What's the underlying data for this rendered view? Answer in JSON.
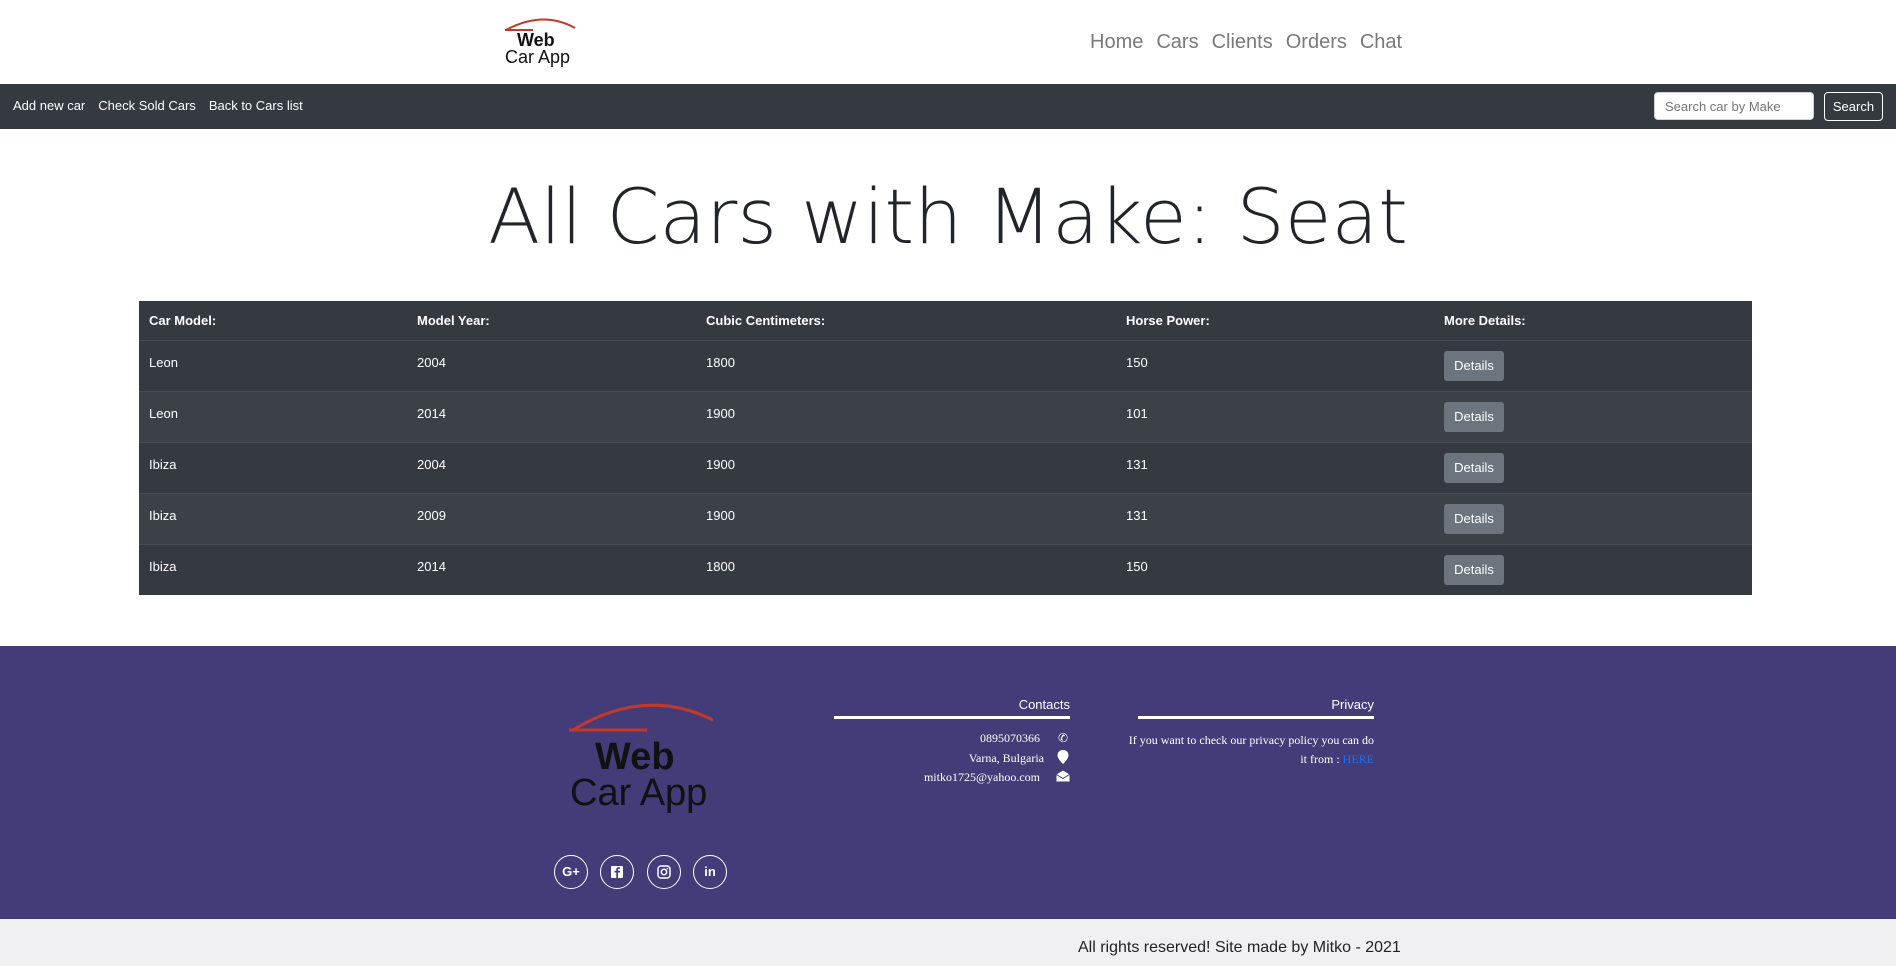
{
  "brand": {
    "line1": "Web",
    "line2": "Car App",
    "accent": "#c0392b"
  },
  "nav": {
    "items": [
      "Home",
      "Cars",
      "Clients",
      "Orders",
      "Chat"
    ]
  },
  "subnav": {
    "links": [
      "Add new car",
      "Check Sold Cars",
      "Back to Cars list"
    ],
    "search_placeholder": "Search car by Make",
    "search_label": "Search"
  },
  "title": "All Cars with Make: Seat",
  "table": {
    "headers": [
      "Car Model:",
      "Model Year:",
      "Cubic Centimeters:",
      "Horse Power:",
      "More Details:"
    ],
    "rows": [
      {
        "model": "Leon",
        "year": "2004",
        "cc": "1800",
        "hp": "150",
        "action": "Details"
      },
      {
        "model": "Leon",
        "year": "2014",
        "cc": "1900",
        "hp": "101",
        "action": "Details"
      },
      {
        "model": "Ibiza",
        "year": "2004",
        "cc": "1900",
        "hp": "131",
        "action": "Details"
      },
      {
        "model": "Ibiza",
        "year": "2009",
        "cc": "1900",
        "hp": "131",
        "action": "Details"
      },
      {
        "model": "Ibiza",
        "year": "2014",
        "cc": "1800",
        "hp": "150",
        "action": "Details"
      }
    ]
  },
  "footer": {
    "contacts_title": "Contacts",
    "phone": "0895070366",
    "address": "Varna, Bulgaria",
    "email": "mitko1725@yahoo.com",
    "privacy_title": "Privacy",
    "privacy_text": "If you want to check our privacy policy you can do it from : ",
    "privacy_link": "HERE",
    "social_icons": [
      "google-plus-icon",
      "facebook-icon",
      "instagram-icon",
      "linkedin-icon"
    ],
    "background": "#433c78"
  },
  "copyright": "All rights reserved! Site made by Mitko - 2021"
}
